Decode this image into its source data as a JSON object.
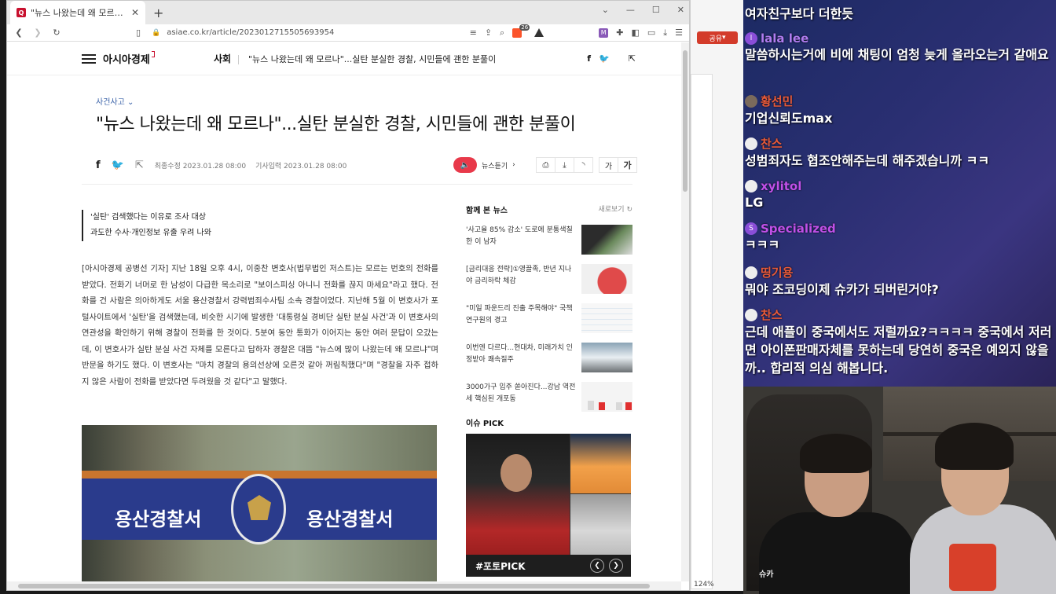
{
  "browser": {
    "tab_title": "\"뉴스 나왔는데 왜 모르나\"...실탄",
    "url": "asiae.co.kr/article/2023012715505693954",
    "brave_count": "26",
    "zoom": "124%"
  },
  "site": {
    "logo": "아시아경제",
    "section": "사회",
    "header_title": "\"뉴스 나왔는데 왜 모르나\"...실탄 분실한 경찰, 시민들에 괜한 분풀이"
  },
  "article": {
    "category": "사건사고",
    "title": "\"뉴스 나왔는데 왜 모르나\"...실탄 분실한 경찰, 시민들에 괜한 분풀이",
    "modified": "최종수정 2023.01.28 08:00",
    "published": "기사입력 2023.01.28 08:00",
    "listen_label": "뉴스듣기",
    "font_small": "가",
    "font_large": "가",
    "summary": [
      "'실탄' 검색했다는 이유로 조사 대상",
      "과도한 수사·개인정보 유출 우려 나와"
    ],
    "body": "[아시아경제 공병선 기자] 지난 18일 오후 4시, 이중찬 변호사(법무법인 저스트)는 모르는 번호의 전화를 받았다. 전화기 너머로 한 남성이 다급한 목소리로 \"보이스피싱 아니니 전화를 끊지 마세요\"라고 했다. 전화를 건 사람은 의아하게도 서울 용산경찰서 강력범죄수사팀 소속 경찰이었다. 지난해 5월 이 변호사가 포털사이트에서 '실탄'을 검색했는데, 비슷한 시기에 발생한 '대통령실 경비단 실탄 분실 사건'과 이 변호사의 연관성을 확인하기 위해 경찰이 전화를 한 것이다. 5분여 동안 통화가 이어지는 동안 여러 문답이 오갔는데, 이 변호사가 실탄 분실 사건 자체를 모른다고 답하자 경찰은 대뜸 \"뉴스에 많이 나왔는데 왜 모르냐\"며 반문을 하기도 했다. 이 변호사는 \"마치 경찰의 용의선상에 오른것 같아 꺼림칙했다\"며 \"경찰을 자주 접하지 않은 사람이 전화를 받았다면 두려웠을 것 같다\"고 말했다.",
    "photo_text_left": "용산경찰서",
    "photo_text_right": "용산경찰서"
  },
  "sidebar": {
    "header": "함께 본 뉴스",
    "refresh": "새로보기",
    "items": [
      {
        "title": "'사고율 85% 감소' 도로에 분통색칠한 이 남자"
      },
      {
        "title": "[금리대응 전략]①영끌족, 반년 지나야 금리하락 체감"
      },
      {
        "title": "\"미일 파운드리 진출 주목해야\" 국책연구원의 경고"
      },
      {
        "title": "이번엔 다르다...현대차, 미래가치 인정받아 쾌속질주"
      },
      {
        "title": "3000가구 입주 쏟아진다...강남 역전세 핵심된 개포동"
      }
    ],
    "issue_header": "이슈 PICK",
    "issue_caption": "#포토PICK"
  },
  "bgwindow": {
    "share": "공유"
  },
  "chat": {
    "messages": [
      {
        "name": "",
        "text": "여자친구보다 더한듯",
        "color": "#ffffff"
      },
      {
        "name": "lala lee",
        "text": "말씀하시는거에 비에 채팅이 엄청 늦게 올라오는거 같애요",
        "color": "#b07cf0"
      },
      {
        "name": "황선민",
        "text": "기업신뢰도max",
        "color": "#e85a3a"
      },
      {
        "name": "찬스",
        "text": "성범죄자도 협조안해주는데 해주겠습니까 ㅋㅋ",
        "color": "#e85a3a"
      },
      {
        "name": "xylitol",
        "text": "LG",
        "color": "#c050e8"
      },
      {
        "name": "Specialized",
        "text": "ㅋㅋㅋ",
        "color": "#c050e8"
      },
      {
        "name": "띵기용",
        "text": "뭐야 조코딩이제 슈카가 되버린거야?",
        "color": "#e85a3a"
      },
      {
        "name": "찬스",
        "text": "근데 애플이 중국에서도 저럴까요?ㅋㅋㅋㅋ 중국에서 저러면 아이폰판매자체를 못하는데 당연히 중국은 예외지 않을까.. 합리적 의심 해봅니다.",
        "color": "#e85a3a"
      }
    ]
  },
  "webcam": {
    "watermark": "슈카"
  }
}
